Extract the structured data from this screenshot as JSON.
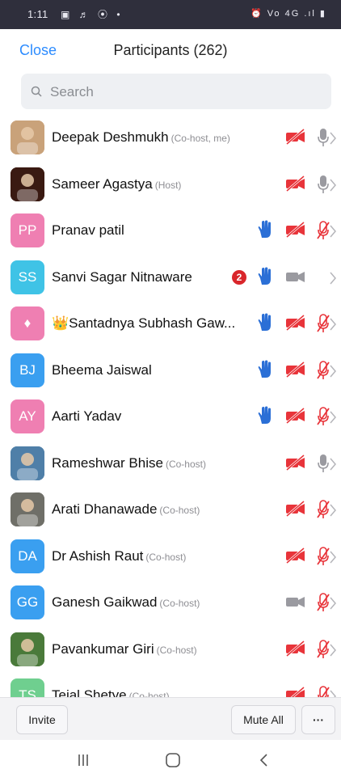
{
  "status_bar": {
    "time": "1:11",
    "left_icons": "▣ ♬ ⦿ •",
    "right_icons": "⏰ Vo 4G .ıl ▮"
  },
  "header": {
    "close_label": "Close",
    "title": "Participants (262)"
  },
  "search": {
    "placeholder": "Search"
  },
  "participants": [
    {
      "name": "Deepak Deshmukh",
      "role": "(Co-host, me)",
      "initials": "",
      "avatar_color": "#c9a27a",
      "hand": false,
      "badge": "",
      "video": "off",
      "mic": "on-gray"
    },
    {
      "name": "Sameer Agastya",
      "role": "(Host)",
      "initials": "",
      "avatar_color": "#3a1a12",
      "hand": false,
      "badge": "",
      "video": "off",
      "mic": "on-gray"
    },
    {
      "name": "Pranav patil",
      "role": "",
      "initials": "PP",
      "avatar_color": "#ef7fb2",
      "hand": true,
      "badge": "",
      "video": "off",
      "mic": "muted"
    },
    {
      "name": "Sanvi Sagar Nitnaware",
      "role": "",
      "initials": "SS",
      "avatar_color": "#3fc3e6",
      "hand": true,
      "badge": "2",
      "video": "gray",
      "mic": "none"
    },
    {
      "name": "👑Santadnya Subhash Gaw...",
      "role": "",
      "initials": "♦",
      "avatar_color": "#ef7fb2",
      "hand": true,
      "badge": "",
      "video": "off",
      "mic": "muted"
    },
    {
      "name": "Bheema Jaiswal",
      "role": "",
      "initials": "BJ",
      "avatar_color": "#3a9ff0",
      "hand": true,
      "badge": "",
      "video": "off",
      "mic": "muted"
    },
    {
      "name": "Aarti Yadav",
      "role": "",
      "initials": "AY",
      "avatar_color": "#ef7fb2",
      "hand": true,
      "badge": "",
      "video": "off",
      "mic": "muted"
    },
    {
      "name": "Rameshwar Bhise",
      "role": "(Co-host)",
      "initials": "",
      "avatar_color": "#4f7fa8",
      "hand": false,
      "badge": "",
      "video": "off",
      "mic": "on-gray"
    },
    {
      "name": "Arati Dhanawade",
      "role": "(Co-host)",
      "initials": "",
      "avatar_color": "#6f6f68",
      "hand": false,
      "badge": "",
      "video": "off",
      "mic": "muted"
    },
    {
      "name": "Dr Ashish Raut",
      "role": "(Co-host)",
      "initials": "DA",
      "avatar_color": "#3a9ff0",
      "hand": false,
      "badge": "",
      "video": "off",
      "mic": "muted"
    },
    {
      "name": "Ganesh Gaikwad",
      "role": "(Co-host)",
      "initials": "GG",
      "avatar_color": "#3a9ff0",
      "hand": false,
      "badge": "",
      "video": "gray",
      "mic": "muted"
    },
    {
      "name": "Pavankumar Giri",
      "role": "(Co-host)",
      "initials": "",
      "avatar_color": "#4a7a3a",
      "hand": false,
      "badge": "",
      "video": "off",
      "mic": "muted"
    },
    {
      "name": "Tejal Shetye",
      "role": "(Co-host)",
      "initials": "TS",
      "avatar_color": "#6fcf8f",
      "hand": false,
      "badge": "",
      "video": "off",
      "mic": "muted"
    }
  ],
  "footer": {
    "invite_label": "Invite",
    "mute_all_label": "Mute All",
    "more_label": "···"
  },
  "nav": {
    "recents_icon": "recent-apps-icon",
    "home_icon": "home-icon",
    "back_icon": "back-icon"
  },
  "colors": {
    "accent": "#2d8cff",
    "muted_red": "#e8343a",
    "hand_blue": "#2b6fd6",
    "badge_red": "#d9262b"
  }
}
